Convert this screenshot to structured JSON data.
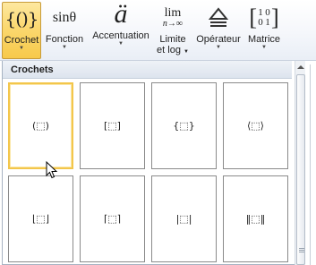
{
  "ribbon": {
    "buttons": [
      {
        "id": "crochet",
        "icon_text": "{()}",
        "label": "Crochet",
        "active": true
      },
      {
        "id": "fonction",
        "icon_text": "sinθ",
        "label": "Fonction"
      },
      {
        "id": "accentuation",
        "icon_text": "ä",
        "label": "Accentuation"
      },
      {
        "id": "limite",
        "icon_top": "lim",
        "icon_bottom": "n→∞",
        "label_line1": "Limite",
        "label_line2": "et log"
      },
      {
        "id": "operateur",
        "icon_text": "≜",
        "label": "Opérateur"
      },
      {
        "id": "matrice",
        "icon_cells": [
          "1",
          "0",
          "0",
          "1"
        ],
        "label": "Matrice"
      }
    ]
  },
  "gallery": {
    "header": "Crochets",
    "tiles": [
      {
        "glyph": "(⬚)",
        "name": "parentheses"
      },
      {
        "glyph": "[⬚]",
        "name": "square-brackets"
      },
      {
        "glyph": "{⬚}",
        "name": "curly-braces"
      },
      {
        "glyph": "⟨⬚⟩",
        "name": "angle-brackets"
      },
      {
        "glyph": "⌊⬚⌋",
        "name": "floor"
      },
      {
        "glyph": "⌈⬚⌉",
        "name": "ceiling"
      },
      {
        "glyph": "|⬚|",
        "name": "absolute-value"
      },
      {
        "glyph": "‖⬚‖",
        "name": "norm"
      }
    ]
  },
  "colors": {
    "active_button": "#f9d978",
    "hover_tile_border": "#f3c64b",
    "tile_border": "#8a8a8a"
  }
}
